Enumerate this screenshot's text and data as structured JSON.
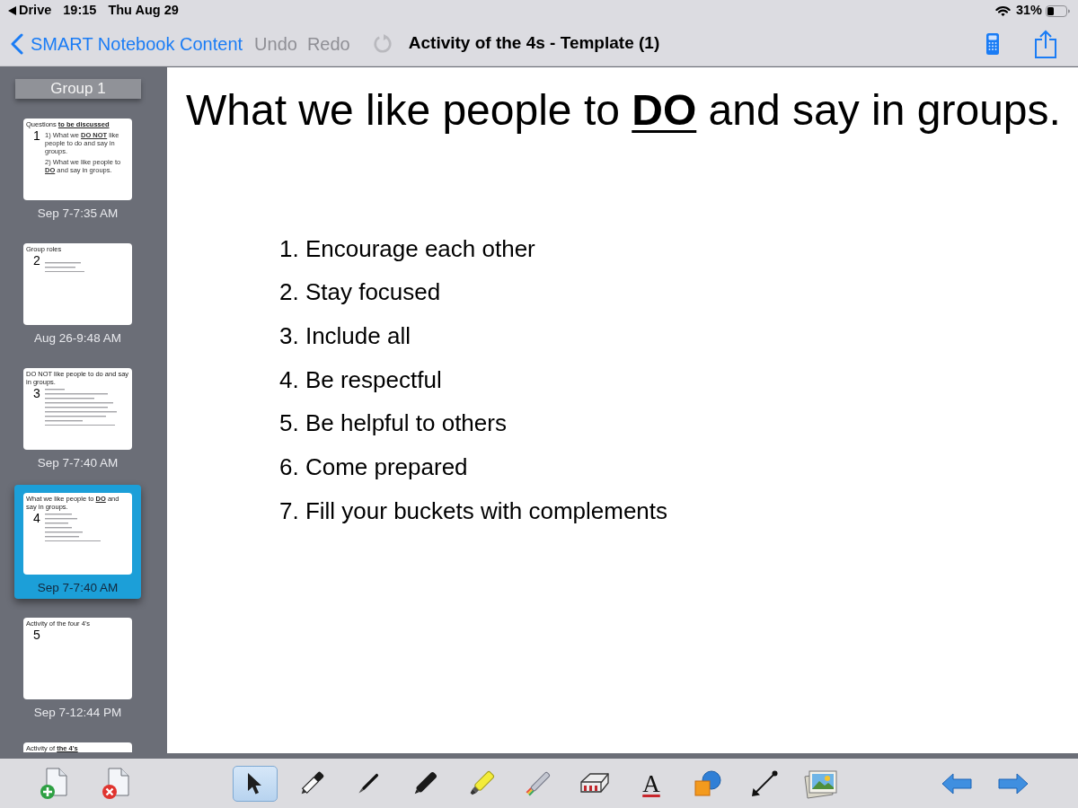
{
  "status_bar": {
    "back_app": "Drive",
    "time": "19:15",
    "date": "Thu Aug 29",
    "battery": "31%"
  },
  "nav_bar": {
    "back": "SMART Notebook Content",
    "actions": [
      {
        "label": "Undo",
        "disabled": true
      },
      {
        "label": "Redo",
        "disabled": true
      }
    ],
    "title": "Activity of the 4s - Template (1)"
  },
  "sidebar": {
    "group": "Group 1",
    "pages": [
      {
        "number": "1",
        "date": "Sep 7-7:35 AM",
        "selected": false,
        "thumbnail": {
          "title": "Questions **to be discussed**",
          "lines": [
            "1) What we **DO NOT** like people to do and say in groups.",
            "2) What we like people to **DO** and say in groups."
          ]
        }
      },
      {
        "number": "2",
        "date": "Aug 26-9:48 AM",
        "selected": false,
        "thumbnail": {
          "title": "Group roles"
        }
      },
      {
        "number": "3",
        "date": "Sep 7-7:40 AM",
        "selected": false,
        "thumbnail": {
          "title": "DO NOT like people to do and say in groups."
        }
      },
      {
        "number": "4",
        "date": "Sep 7-7:40 AM",
        "selected": true,
        "thumbnail": {
          "title": "What we like people to **DO** and say in groups."
        }
      },
      {
        "number": "5",
        "date": "Sep 7-12:44 PM",
        "selected": false,
        "thumbnail": {
          "title": "Activity of the four 4's"
        }
      },
      {
        "selected": false,
        "thumbnail": {
          "title": "Activity of **the 4's**"
        }
      }
    ]
  },
  "slide": {
    "title": "What we like people to **DO** and say in groups.",
    "items": [
      "1. Encourage each other",
      "2. Stay focused",
      "3. Include all",
      "4. Be respectful",
      "5. Be helpful to others",
      "6. Come prepared",
      "7. Fill your buckets with complements"
    ]
  },
  "toolbar": {
    "page_actions": [
      {
        "kind": "add"
      },
      {
        "kind": "delete"
      }
    ],
    "tools": [
      {
        "kind": "select",
        "selected": true
      },
      {
        "kind": "pen",
        "selected": false
      },
      {
        "kind": "calligraphy",
        "selected": false
      },
      {
        "kind": "marker",
        "selected": false
      },
      {
        "kind": "highlighter",
        "selected": false
      },
      {
        "kind": "creative",
        "selected": false
      },
      {
        "kind": "eraser",
        "selected": false
      },
      {
        "kind": "text",
        "glyph": "A",
        "selected": false
      },
      {
        "kind": "shapes",
        "selected": false
      },
      {
        "kind": "line",
        "selected": false
      },
      {
        "kind": "image",
        "selected": false
      }
    ],
    "navigation": [
      {
        "kind": "previous"
      },
      {
        "kind": "next"
      }
    ]
  }
}
